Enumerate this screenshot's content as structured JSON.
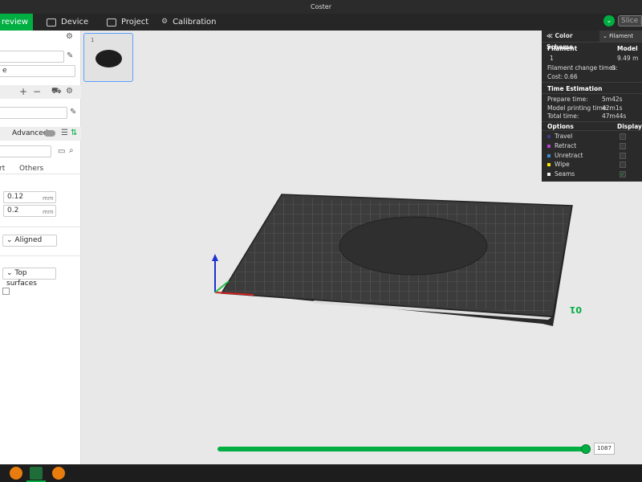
{
  "window": {
    "title": "Coster"
  },
  "menu": {
    "tabs": [
      {
        "label": "review"
      },
      {
        "label": "Device"
      },
      {
        "label": "Project"
      },
      {
        "label": "Calibration"
      }
    ],
    "slice_label": "Slice p"
  },
  "sidebar": {
    "field1_value": "",
    "field2_value": "e",
    "advanced_label": "Advanced",
    "search_value": "",
    "tabs": [
      "rt",
      "Others"
    ],
    "layer_height_value": "0.12",
    "first_layer_value": "0.2",
    "unit_mm": "mm",
    "seam_option": "Aligned",
    "ironing_option": "Top surfaces"
  },
  "plate": {
    "number": "1",
    "corner_label": "01"
  },
  "stats": {
    "color_scheme_label": "Color Scheme",
    "filament_tab_label": "Filament",
    "filament_header": "Filament",
    "model_header": "Model",
    "filament_row_index": "1",
    "filament_row_value": "9.49 m",
    "filament_change_label": "Filament change times:",
    "filament_change_value": "0",
    "cost_label": "Cost:",
    "cost_value": "0.66",
    "time_estimation_label": "Time Estimation",
    "prepare_label": "Prepare time:",
    "prepare_value": "5m42s",
    "model_time_label": "Model printing time:",
    "model_time_value": "42m1s",
    "total_label": "Total time:",
    "total_value": "47m44s",
    "options_label": "Options",
    "display_label": "Display",
    "options": [
      {
        "label": "Travel",
        "color": "#3b3b8f",
        "checked": false
      },
      {
        "label": "Retract",
        "color": "#b83fd0",
        "checked": false
      },
      {
        "label": "Unretract",
        "color": "#3f8ad0",
        "checked": false
      },
      {
        "label": "Wipe",
        "color": "#ffe600",
        "checked": false
      },
      {
        "label": "Seams",
        "color": "#f0f0f0",
        "checked": true
      }
    ]
  },
  "slider": {
    "value": "1087",
    "position_fraction": 1.0
  },
  "colors": {
    "accent": "#00ae42",
    "panel_dark": "#2a2a2a"
  }
}
